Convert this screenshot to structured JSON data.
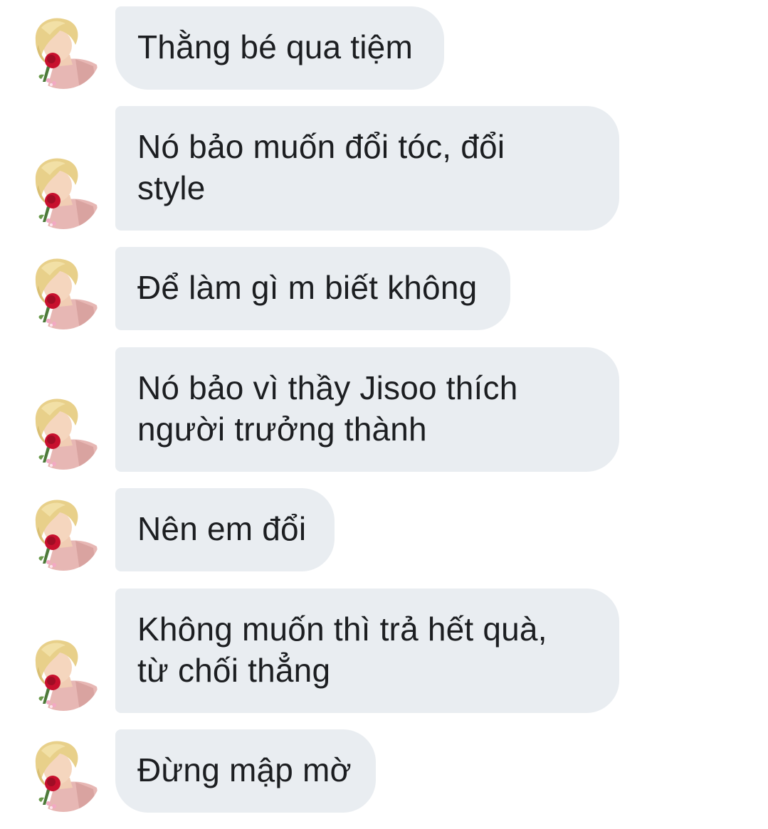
{
  "conversation": {
    "avatar_icon": "user-avatar-blonde-with-rose",
    "bubble_color": "#e9edf1",
    "text_color": "#1c1e21",
    "messages": [
      {
        "text": "Thằng bé qua tiệm"
      },
      {
        "text": "Nó bảo muốn đổi tóc, đổi\nstyle"
      },
      {
        "text": "Để làm gì m biết không"
      },
      {
        "text": "Nó bảo vì thầy Jisoo thích\nngười trưởng thành"
      },
      {
        "text": "Nên em đổi"
      },
      {
        "text": "Không muốn thì trả hết quà,\ntừ chối thẳng"
      },
      {
        "text": "Đừng mập mờ"
      }
    ]
  }
}
